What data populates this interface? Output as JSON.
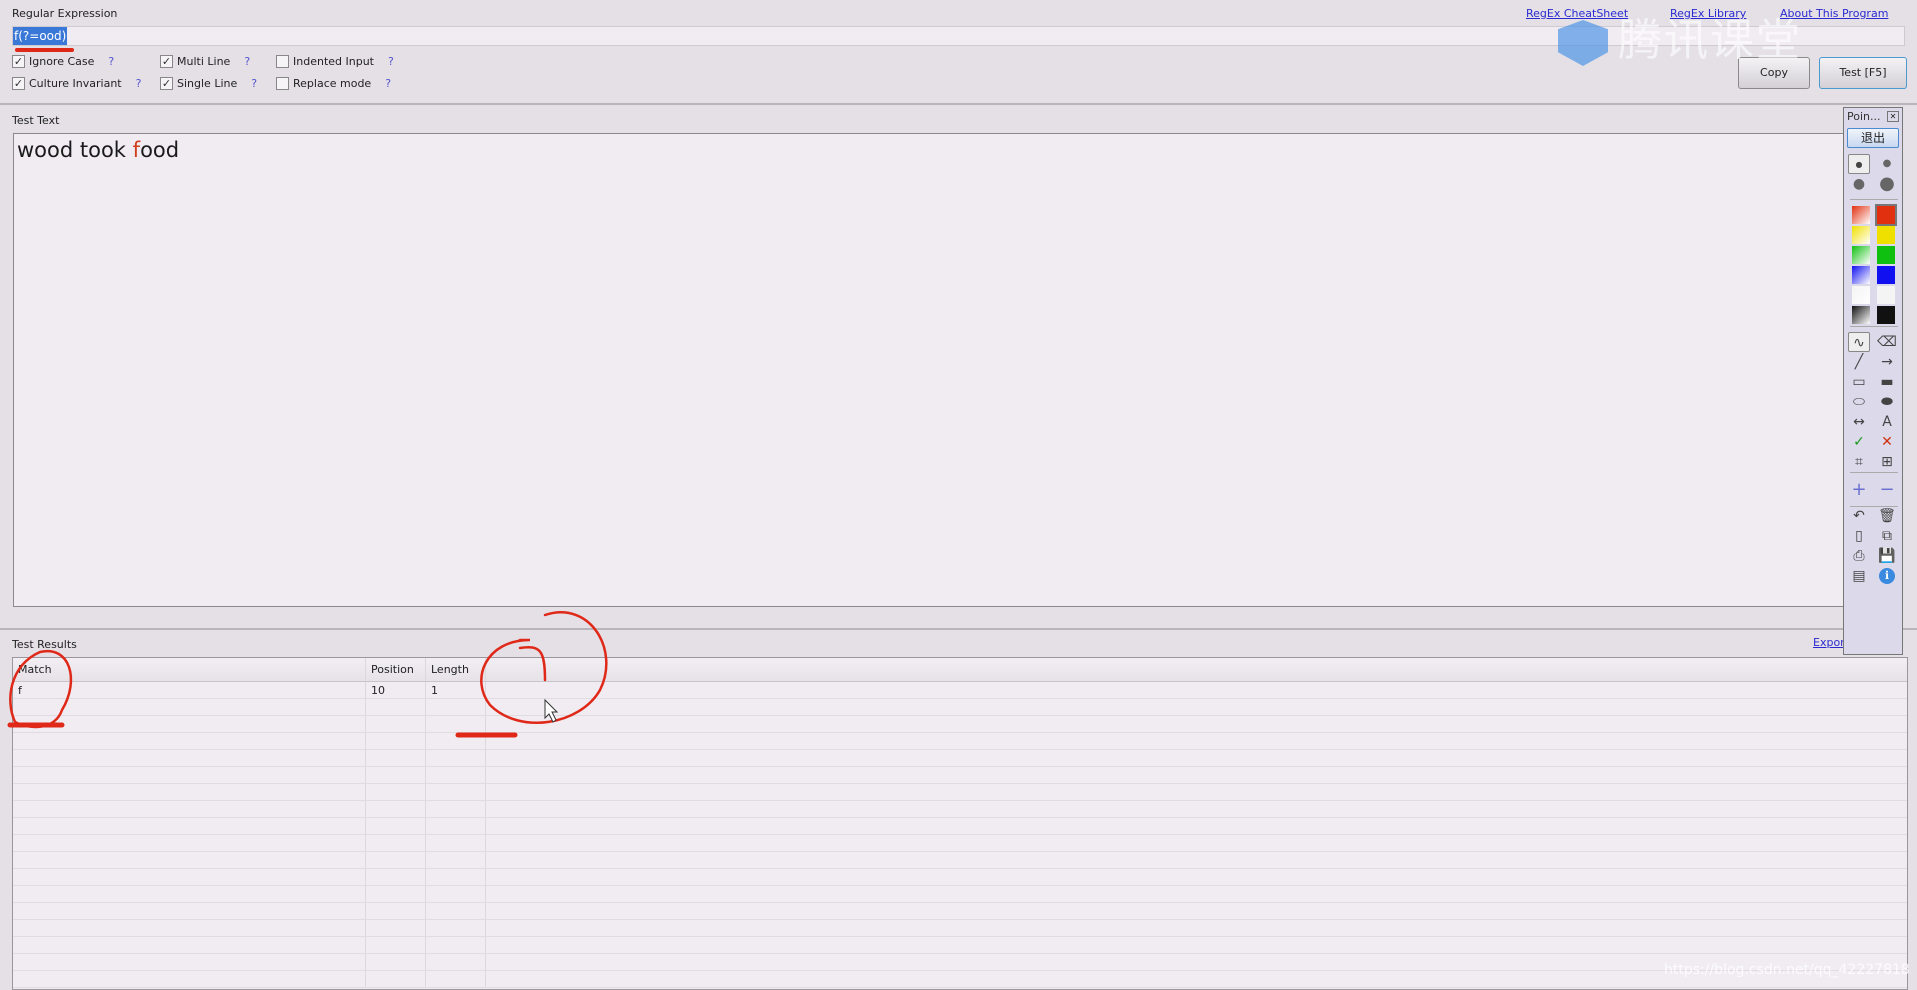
{
  "regex": {
    "label": "Regular Expression",
    "value": "f(?=ood)",
    "links": [
      "RegEx CheatSheet",
      "RegEx Library",
      "About This Program"
    ],
    "options": [
      {
        "label": "Ignore Case",
        "checked": true,
        "help": "?"
      },
      {
        "label": "Multi Line",
        "checked": true,
        "help": "?"
      },
      {
        "label": "Indented Input",
        "checked": false,
        "help": "?"
      },
      {
        "label": "Culture Invariant",
        "checked": true,
        "help": "?"
      },
      {
        "label": "Single Line",
        "checked": true,
        "help": "?"
      },
      {
        "label": "Replace mode",
        "checked": false,
        "help": "?"
      }
    ],
    "copy_label": "Copy",
    "test_label": "Test [F5]"
  },
  "test_text": {
    "label": "Test Text",
    "before": "wood took ",
    "match": "f",
    "after": "ood",
    "match_color": "#d04020"
  },
  "results": {
    "label": "Test Results",
    "export_label": "Export",
    "columns": [
      "Match",
      "Position",
      "Length"
    ],
    "rows": [
      {
        "match": "f",
        "position": "10",
        "length": "1"
      }
    ]
  },
  "pointer_toolbar": {
    "title": "Poin...",
    "exit_label": "退出",
    "colors": [
      "#e03010",
      "#f0e000",
      "#10c010",
      "#1010f0",
      "#f4f4f4",
      "#111111"
    ],
    "tools": [
      "pen-icon",
      "eraser-icon",
      "line-icon",
      "arrow-icon",
      "rectangle-icon",
      "filled-rectangle-icon",
      "ellipse-icon",
      "filled-ellipse-icon",
      "double-arrow-icon",
      "text-icon",
      "check-icon",
      "cross-icon",
      "crop-icon",
      "zoom-icon",
      "plus-icon",
      "minus-icon",
      "undo-icon",
      "trash-icon",
      "new-page-icon",
      "copy-icon",
      "print-icon",
      "save-icon",
      "screen-icon",
      "info-icon"
    ]
  },
  "watermarks": {
    "logo": "腾讯课堂",
    "url": "https://blog.csdn.net/qq_42227818"
  },
  "annotation_color": "#e02818"
}
